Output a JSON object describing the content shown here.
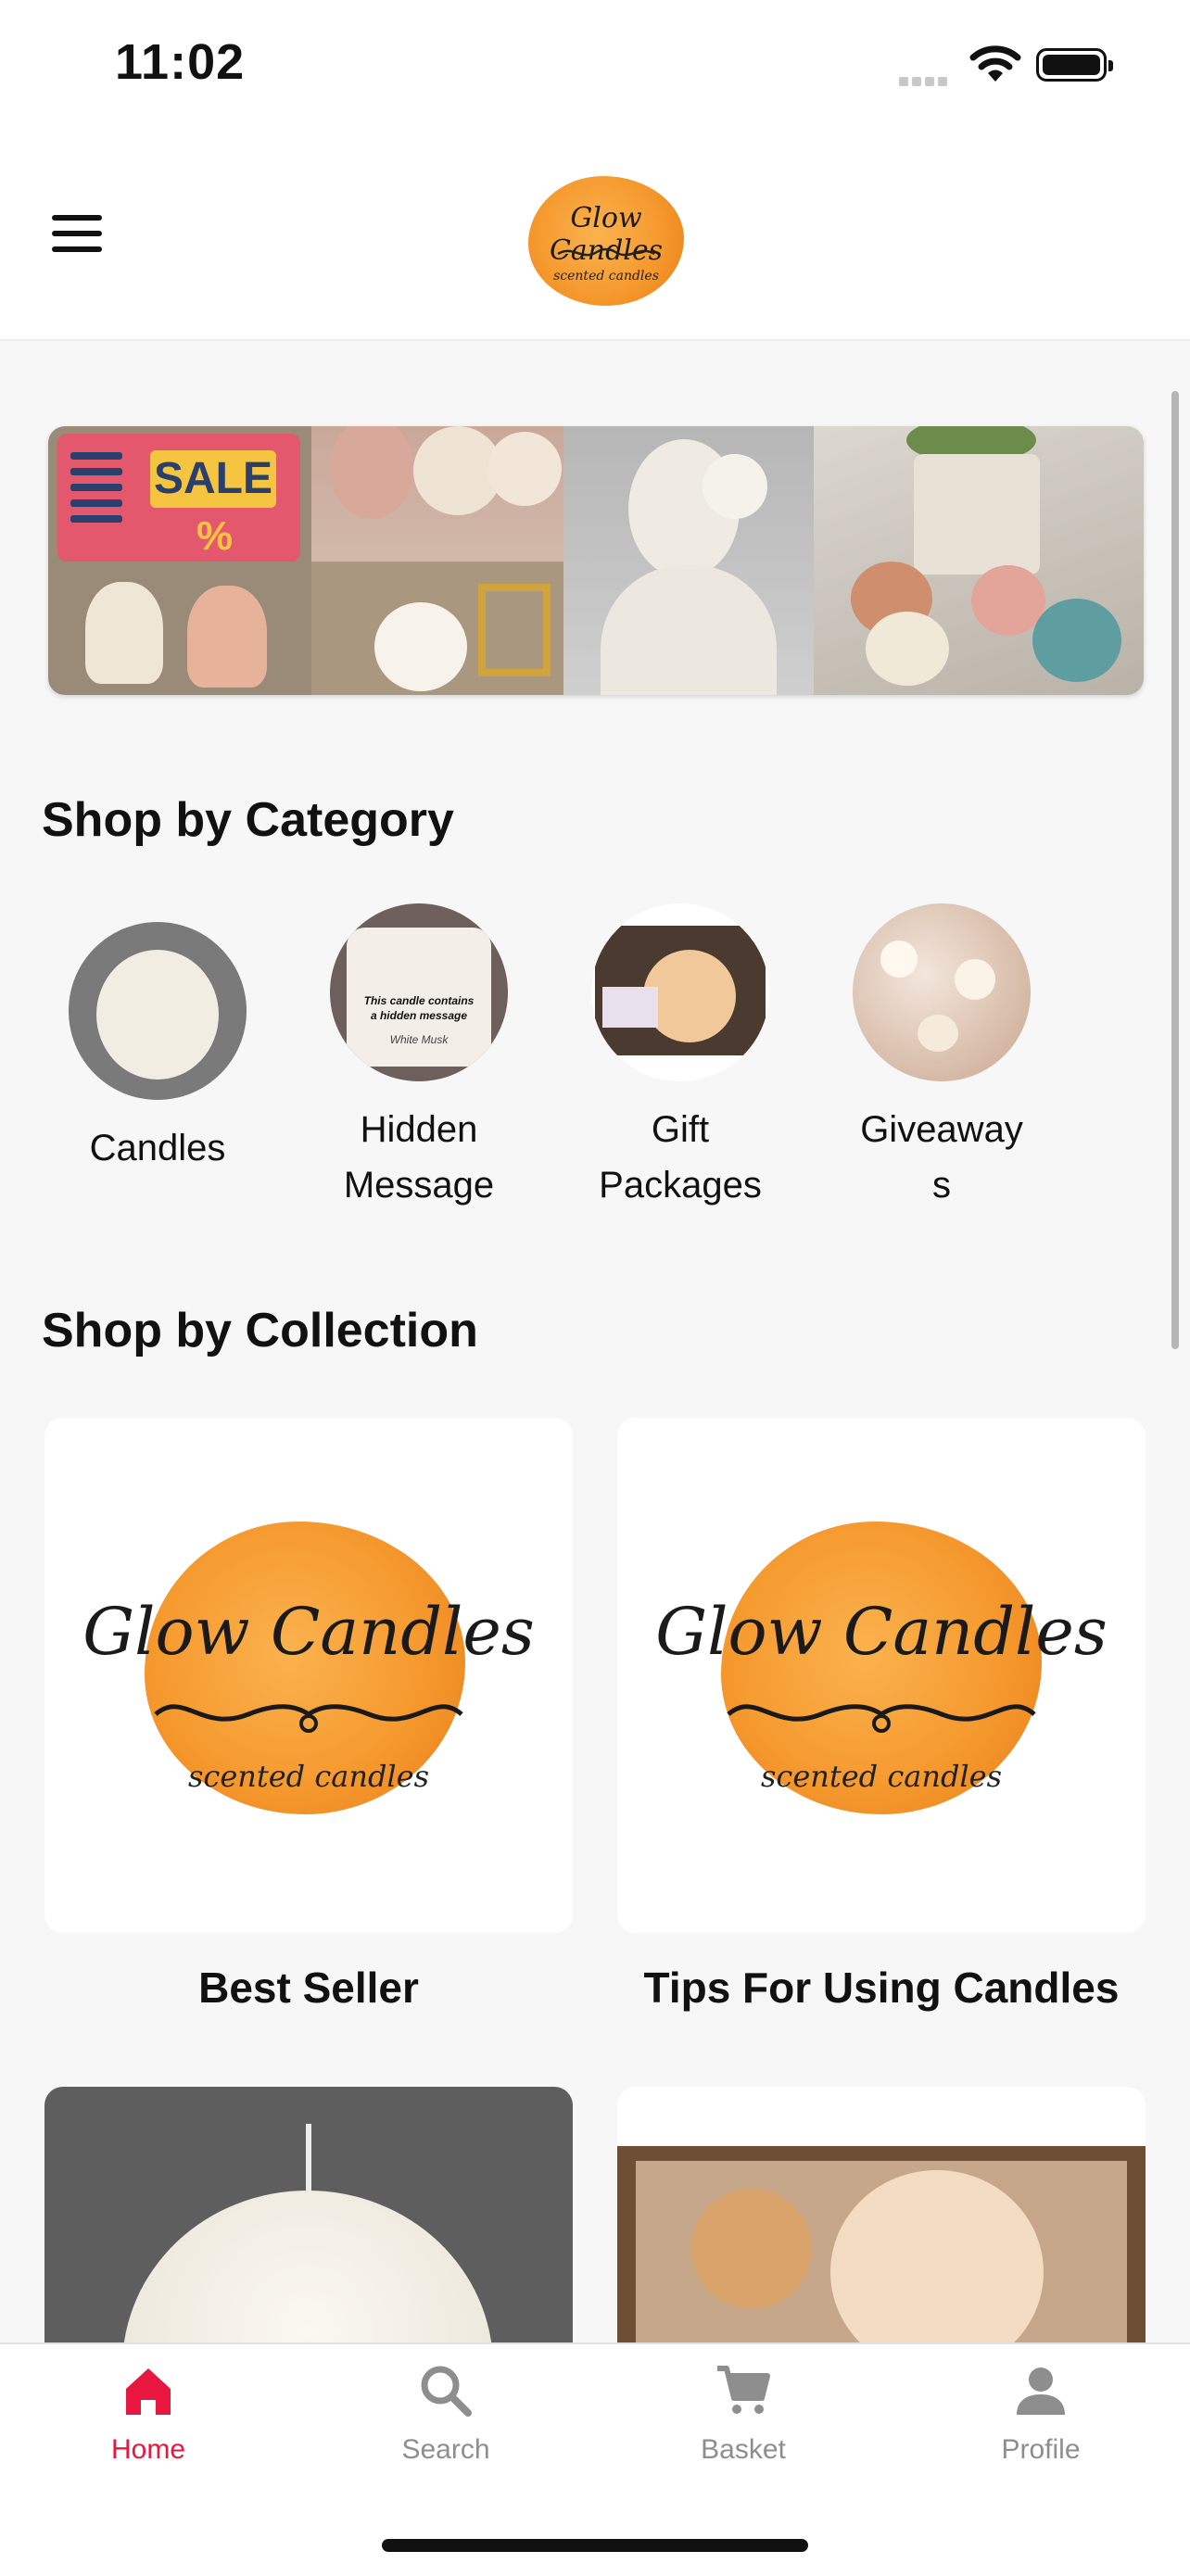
{
  "status_bar": {
    "time": "11:02"
  },
  "header": {
    "logo_title": "Glow Candles",
    "logo_subtitle": "scented candles"
  },
  "banner": {
    "sale_text": "SALE",
    "sale_symbol": "%"
  },
  "category_section": {
    "title": "Shop by Category",
    "items": [
      {
        "label": "Candles"
      },
      {
        "label": "Hidden Message",
        "line1": "Hidden",
        "line2": "Message",
        "thumb_text1": "This candle contains",
        "thumb_text2": "a hidden message",
        "thumb_text3": "White Musk"
      },
      {
        "label": "Gift Packages",
        "line1": "Gift",
        "line2": "Packages"
      },
      {
        "label": "Giveaways",
        "line1": "Giveaway",
        "line2": "s"
      }
    ]
  },
  "collection_section": {
    "title": "Shop by Collection",
    "items": [
      {
        "label": "Best Seller",
        "logo_title": "Glow Candles",
        "logo_subtitle": "scented candles"
      },
      {
        "label": "Tips For Using Candles",
        "logo_title": "Glow Candles",
        "logo_subtitle": "scented candles"
      }
    ]
  },
  "tab_bar": {
    "tabs": [
      {
        "label": "Home",
        "icon": "home-icon",
        "active": true
      },
      {
        "label": "Search",
        "icon": "search-icon",
        "active": false
      },
      {
        "label": "Basket",
        "icon": "cart-icon",
        "active": false
      },
      {
        "label": "Profile",
        "icon": "person-icon",
        "active": false
      }
    ]
  },
  "colors": {
    "accent": "#e8173f",
    "inactive": "#8e8e8e",
    "logo_orange": "#f59a2f"
  }
}
